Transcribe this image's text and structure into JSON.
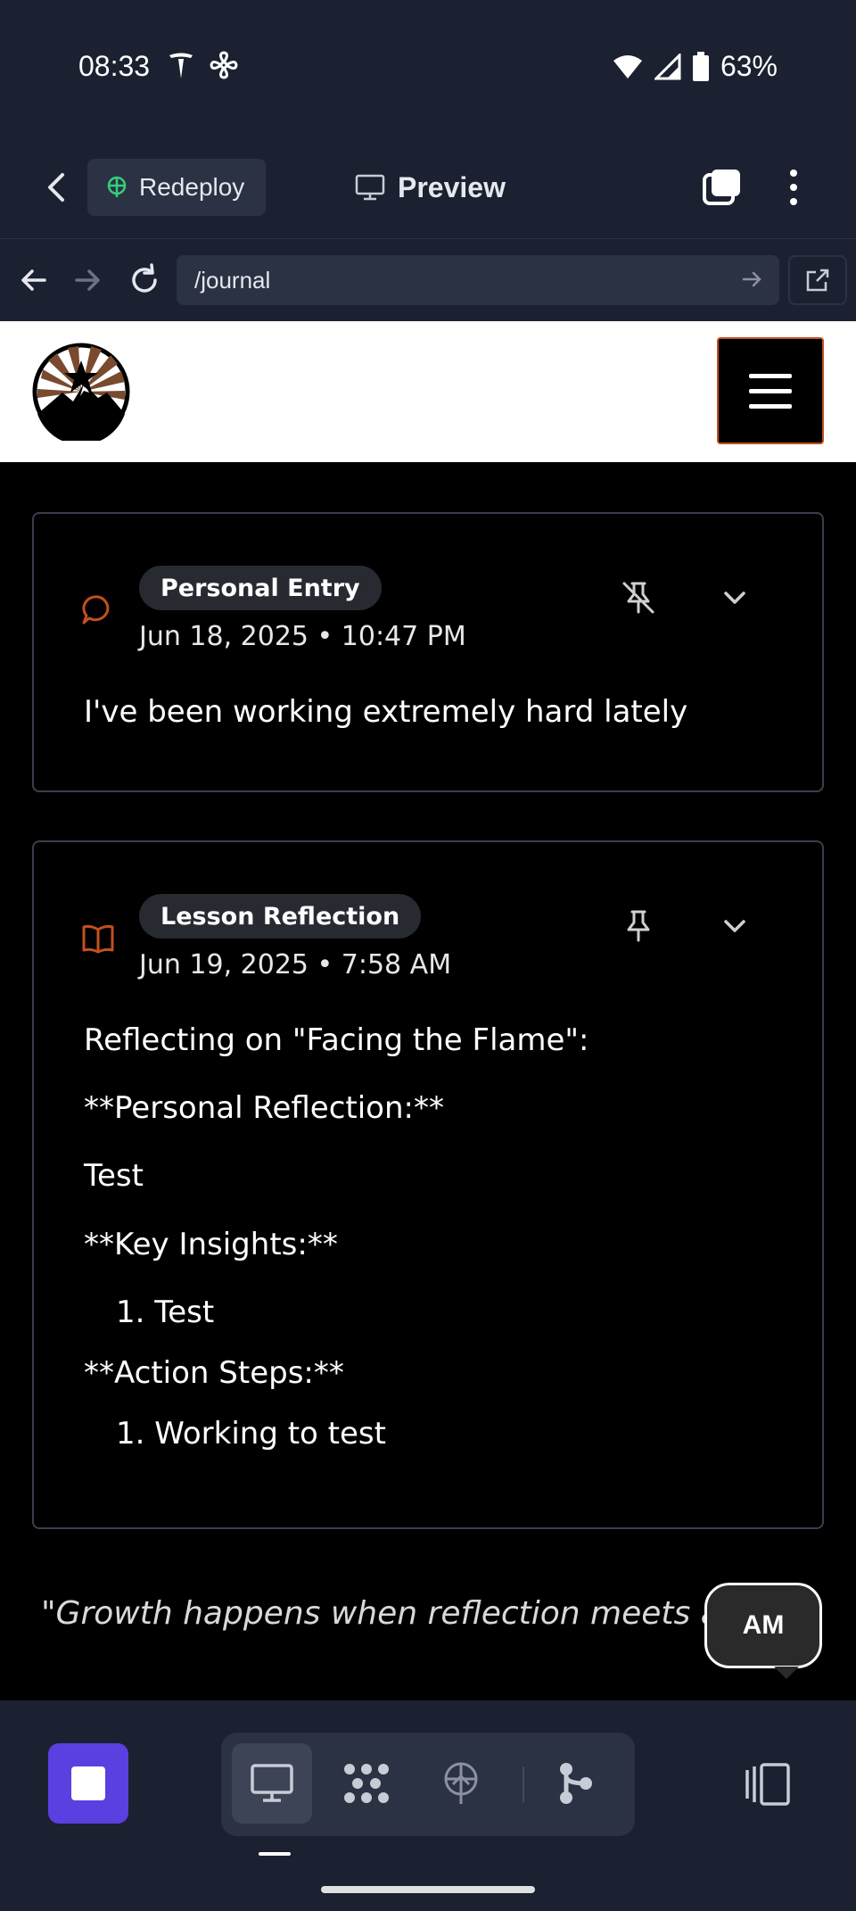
{
  "status_bar": {
    "time": "08:33",
    "battery": "63%",
    "icons": [
      "tesla-icon",
      "fan-icon",
      "wifi-icon",
      "signal-icon",
      "battery-icon"
    ]
  },
  "app_bar": {
    "redeploy_label": "Redeploy",
    "preview_label": "Preview"
  },
  "url_bar": {
    "path": "/journal"
  },
  "entries": [
    {
      "type_label": "Personal Entry",
      "date": "Jun 18, 2025 • 10:47 PM",
      "pinned": false,
      "body": "I've been working extremely hard lately"
    },
    {
      "type_label": "Lesson Reflection",
      "date": "Jun 19, 2025 • 7:58 AM",
      "pinned": true,
      "intro": "Reflecting on \"Facing the Flame\":",
      "personal_heading": "**Personal Reflection:**",
      "personal_text": "Test",
      "insights_heading": "**Key Insights:**",
      "insights_item": "1. Test",
      "actions_heading": "**Action Steps:**",
      "actions_item": "1. Working to test"
    }
  ],
  "quote": "\"Growth happens when reflection meets a",
  "avatar_initials": "AM",
  "colors": {
    "chrome_bg": "#1b2130",
    "chrome_field": "#2b3243",
    "accent_orange": "#c2501f",
    "stop_purple": "#5a40e0",
    "badge_bg": "#272a31"
  }
}
